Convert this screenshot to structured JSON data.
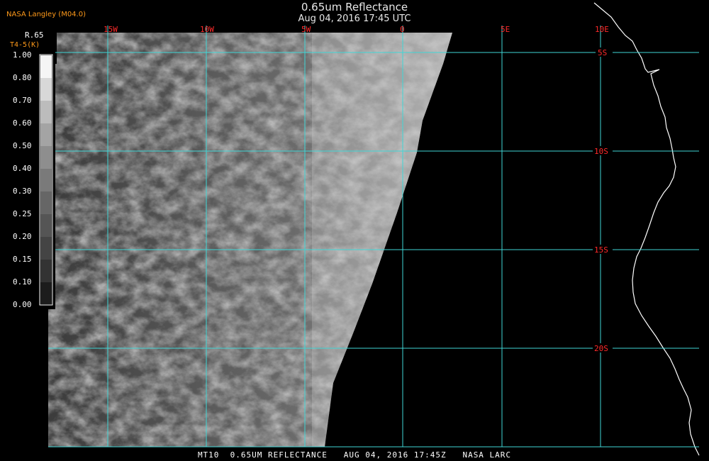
{
  "header": {
    "agency": "NASA Langley (M04.0)",
    "title": "0.65um Reflectance",
    "subtitle": "Aug 04, 2016 17:45 UTC"
  },
  "product": {
    "label": "R.65",
    "sublabel": "T4-5(K)"
  },
  "legend": {
    "values": [
      "1.00",
      "0.80",
      "0.70",
      "0.60",
      "0.50",
      "0.40",
      "0.30",
      "0.25",
      "0.20",
      "0.15",
      "0.10",
      "0.00"
    ]
  },
  "grid": {
    "longitudes": [
      "15W",
      "10W",
      "5W",
      "0",
      "5E",
      "10E"
    ],
    "latitudes": [
      "5S",
      "10S",
      "15S",
      "20S"
    ]
  },
  "footer": {
    "text": "MT10  0.65UM REFLECTANCE   AUG 04, 2016 17:45Z   NASA LARC"
  },
  "colors": {
    "grid": "#3fd6d6",
    "grid_label": "#ff2a2a",
    "agency": "#ff9a1a",
    "coastline": "#ffffff"
  }
}
